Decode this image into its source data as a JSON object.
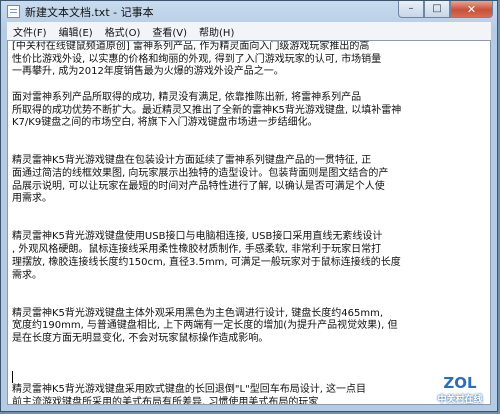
{
  "window": {
    "title": "新建文本文档.txt - 记事本",
    "controls": {
      "minimize": "–",
      "maximize": "□",
      "close": "✕"
    }
  },
  "menu": [
    "文件(F)",
    "编辑(E)",
    "格式(O)",
    "查看(V)",
    "帮助(H)"
  ],
  "document": {
    "lines": [
      "    [中关村在线键鼠频道原创] 雷神系列产品, 作为精灵面向入门级游戏玩家推出的高",
      "性价比游戏外设, 以实惠的价格和绚丽的外观, 得到了入门游戏玩家的认可, 市场销量",
      "一再攀升, 成为2012年度销售最为火爆的游戏外设产品之一。",
      "",
      "    面对雷神系列产品所取得的成功, 精灵没有满足, 依靠推陈出新, 将雷神系列产品",
      "所取得的成功优势不断扩大。最近精灵又推出了全新的雷神K5背光游戏键盘, 以填补雷神",
      "K7/K9键盘之间的市场空白, 将旗下入门游戏键盘市场进一步结细化。",
      "",
      "",
      "    精灵雷神K5背光游戏键盘在包装设计方面延续了雷神系列键盘产品的一贯特征, 正",
      "面通过简洁的线框效果图, 向玩家展示出独特的造型设计。包装背面则是图文结合的产",
      "品展示说明, 可以让玩家在最短的时间对产品特性进行了解, 以确认是否可满足个人使",
      "用需求。",
      "",
      "",
      "    精灵雷神K5背光游戏键盘使用USB接口与电脑相连接, USB接口采用直线无紊线设计",
      ", 外观风格硬朗。鼠标连接线采用柔性橡胶材质制作, 手感柔软, 非常利于玩家日常打",
      "理摆放, 橡胶连接线长度约150cm, 直径3.5mm, 可满足一般玩家对于鼠标连接线的长度",
      "需求。",
      "",
      "",
      "    精灵雷神K5背光游戏键盘主体外观采用黑色为主色调进行设计, 键盘长度约465mm,",
      "宽度约190mm, 与普通键盘相比, 上下两端有一定长度的增加(为提升产品视觉效果), 但",
      "是在长度方面无明显变化, 不会对玩家鼠标操作造成影响。",
      "",
      "",
      "",
      "    精灵雷神K5背光游戏键盘采用欧式键盘的长回退倒\"L\"型回车布局设计, 这一点目",
      "前主流游戏键盘所采用的美式布局有所差异, 习惯使用美式布局的玩家"
    ],
    "cursor_line": 26
  },
  "watermark": {
    "logo": "ZOL",
    "caption": "中关村在线"
  }
}
